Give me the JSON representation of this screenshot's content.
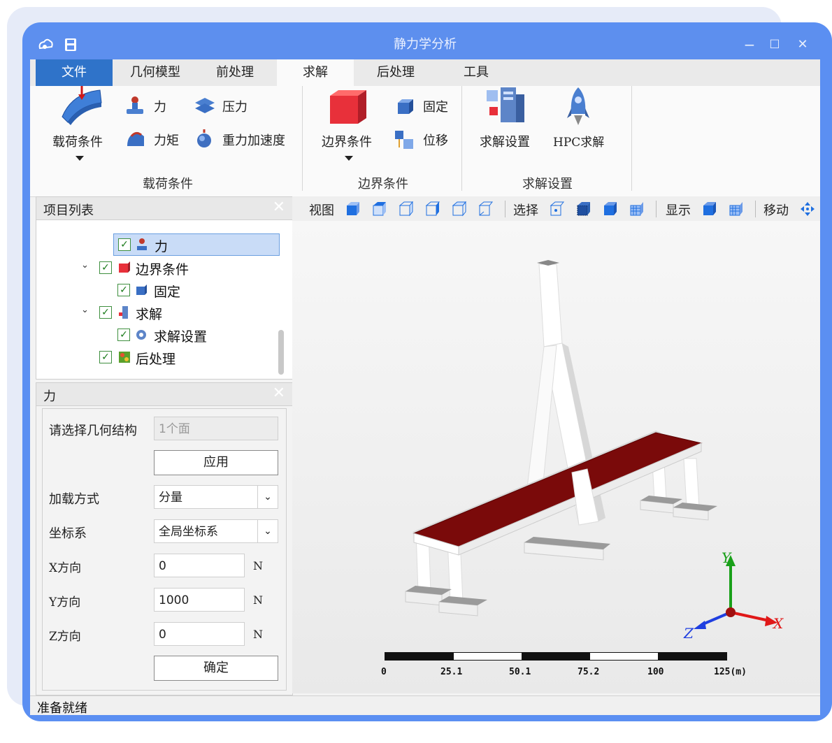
{
  "window": {
    "title": "静力学分析",
    "minimize": "−",
    "maximize": "☐",
    "close": "✕"
  },
  "tabs": [
    "文件",
    "几何模型",
    "前处理",
    "求解",
    "后处理",
    "工具"
  ],
  "ribbon": {
    "load": {
      "big_label": "载荷条件",
      "force": "力",
      "pressure": "压力",
      "moment": "力矩",
      "gravity": "重力加速度",
      "group_label": "载荷条件"
    },
    "boundary": {
      "big_label": "边界条件",
      "fixed": "固定",
      "displacement": "位移",
      "group_label": "边界条件"
    },
    "solve": {
      "settings": "求解设置",
      "hpc": "HPC求解",
      "group_label": "求解设置"
    }
  },
  "project_panel": {
    "title": "项目列表",
    "items": [
      {
        "label": "力",
        "level": 2,
        "checked": true,
        "selected": true
      },
      {
        "label": "边界条件",
        "level": 1,
        "checked": true,
        "expanded": true
      },
      {
        "label": "固定",
        "level": 2,
        "checked": true
      },
      {
        "label": "求解",
        "level": 1,
        "checked": true,
        "expanded": true
      },
      {
        "label": "求解设置",
        "level": 2,
        "checked": true
      },
      {
        "label": "后处理",
        "level": 1,
        "checked": true
      }
    ]
  },
  "force_panel": {
    "title": "力",
    "select_label": "请选择几何结构",
    "select_value": "1个面",
    "apply_button": "应用",
    "load_mode_label": "加载方式",
    "load_mode_value": "分量",
    "coord_label": "坐标系",
    "coord_value": "全局坐标系",
    "x_label": "X方向",
    "x_value": "0",
    "x_unit": "N",
    "y_label": "Y方向",
    "y_value": "1000",
    "y_unit": "N",
    "z_label": "Z方向",
    "z_value": "0",
    "z_unit": "N",
    "ok_button": "确定"
  },
  "viewport_toolbar": {
    "view": "视图",
    "select": "选择",
    "display": "显示",
    "move": "移动"
  },
  "axes": {
    "x": "X",
    "y": "Y",
    "z": "Z"
  },
  "scale_bar": {
    "ticks": [
      "0",
      "25.1",
      "50.1",
      "75.2",
      "100",
      "125(m)"
    ]
  },
  "status": "准备就绪",
  "colors": {
    "accent": "#5d8fee",
    "active_tab": "#2f73c9",
    "deck": "#7a0a0a"
  }
}
